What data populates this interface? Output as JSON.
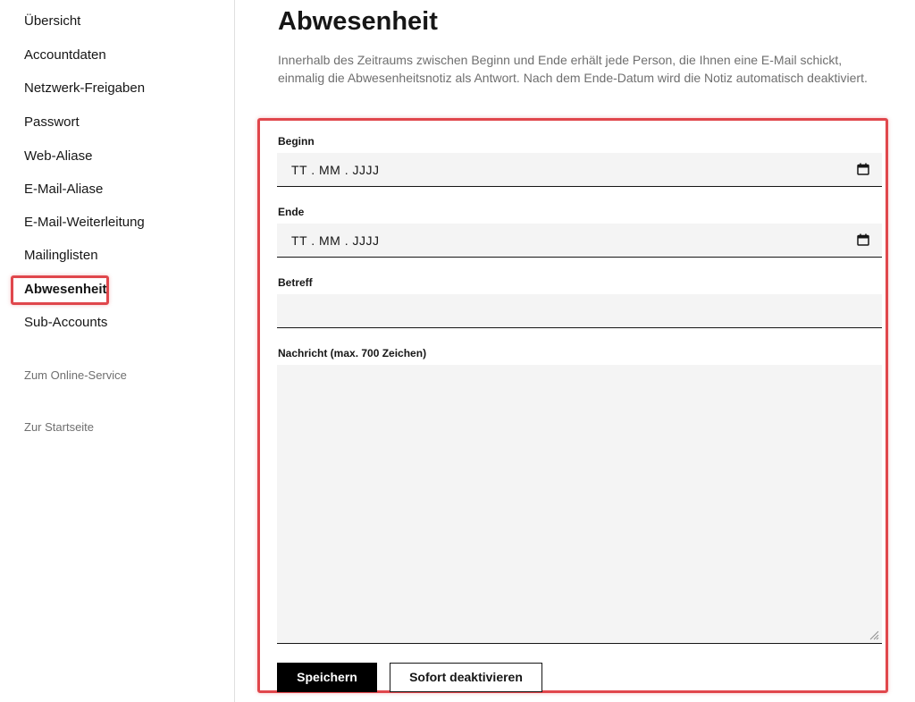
{
  "sidebar": {
    "items": [
      {
        "label": "Übersicht"
      },
      {
        "label": "Accountdaten"
      },
      {
        "label": "Netzwerk-Freigaben"
      },
      {
        "label": "Passwort"
      },
      {
        "label": "Web-Aliase"
      },
      {
        "label": "E-Mail-Aliase"
      },
      {
        "label": "E-Mail-Weiterleitung"
      },
      {
        "label": "Mailinglisten"
      },
      {
        "label": "Abwesenheit",
        "active": true
      },
      {
        "label": "Sub-Accounts"
      }
    ],
    "links": [
      {
        "label": "Zum Online-Service"
      },
      {
        "label": "Zur Startseite"
      }
    ]
  },
  "main": {
    "title": "Abwesenheit",
    "intro": "Innerhalb des Zeitraums zwischen Beginn und Ende erhält jede Person, die Ihnen eine E-Mail schickt, einmalig die Abwesenheitsnotiz als Antwort. Nach dem Ende-Datum wird die Notiz automatisch deaktiviert.",
    "form": {
      "begin": {
        "label": "Beginn",
        "placeholder": "TT . MM . JJJJ",
        "icon": "calendar-icon"
      },
      "end": {
        "label": "Ende",
        "placeholder": "TT . MM . JJJJ",
        "icon": "calendar-icon"
      },
      "subject": {
        "label": "Betreff",
        "value": ""
      },
      "message": {
        "label": "Nachricht (max. 700 Zeichen)",
        "value": ""
      },
      "save_label": "Speichern",
      "deactivate_label": "Sofort deaktivieren"
    }
  },
  "colors": {
    "highlight": "#e0474c",
    "field_bg": "#f4f4f4",
    "primary_button": "#000000",
    "muted_text": "#6f6f6f"
  }
}
